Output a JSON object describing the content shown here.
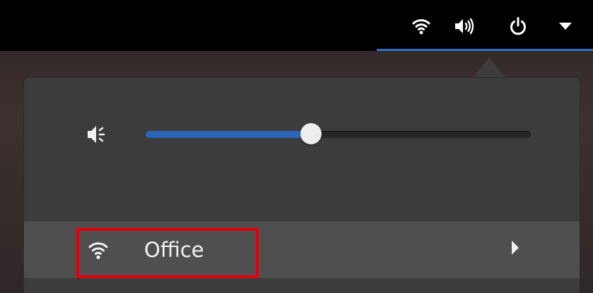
{
  "topbar": {
    "icons": [
      "wifi-icon",
      "speaker-icon",
      "power-icon",
      "caret-down-icon"
    ],
    "accent_color": "#2c6ec6"
  },
  "popup": {
    "volume": {
      "icon": "speaker-low-icon",
      "level": 0.43
    },
    "network": {
      "icon": "wifi-icon",
      "label": "Office",
      "expand_icon": "chevron-right-icon"
    }
  },
  "annotation": {
    "highlight_color": "#e3000b"
  }
}
